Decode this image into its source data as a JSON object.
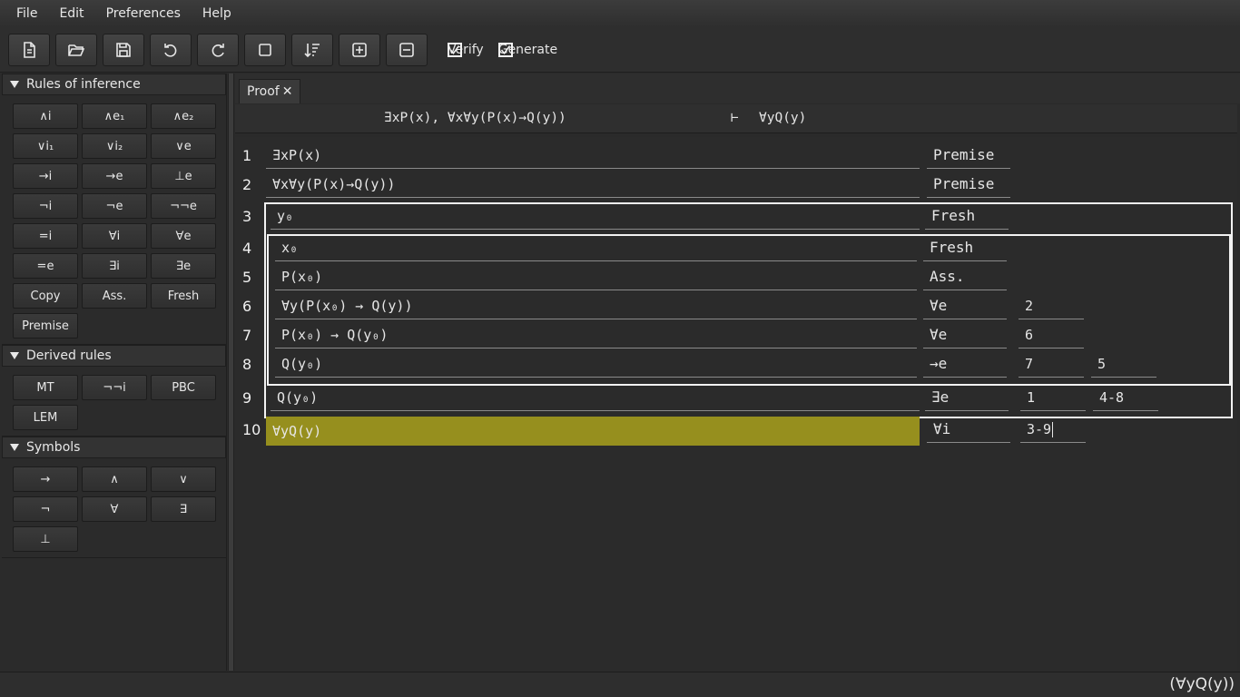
{
  "menu": [
    "File",
    "Edit",
    "Preferences",
    "Help"
  ],
  "toolbar": {
    "buttons": [
      "new-file-icon",
      "open-folder-icon",
      "save-icon",
      "undo-icon",
      "redo-icon",
      "square-icon",
      "sort-icon",
      "add-line-icon",
      "remove-line-icon"
    ],
    "verify_label": "Verify",
    "verify_checked": true,
    "generate_label": "Generate",
    "generate_checked": true
  },
  "sidebar": {
    "rules_title": "Rules of inference",
    "rules": [
      "∧i",
      "∧e₁",
      "∧e₂",
      "∨i₁",
      "∨i₂",
      "∨e",
      "→i",
      "→e",
      "⊥e",
      "¬i",
      "¬e",
      "¬¬e",
      "=i",
      "∀i",
      "∀e",
      "=e",
      "∃i",
      "∃e",
      "Copy",
      "Ass.",
      "Fresh",
      "Premise"
    ],
    "derived_title": "Derived rules",
    "derived": [
      "MT",
      "¬¬i",
      "PBC",
      "LEM"
    ],
    "symbols_title": "Symbols",
    "symbols": [
      "→",
      "∧",
      "∨",
      "¬",
      "∀",
      "∃",
      "⊥"
    ]
  },
  "tab": {
    "label": "Proof",
    "close": "✕"
  },
  "sequent": {
    "premises": "∃xP(x), ∀x∀y(P(x)→Q(y))",
    "turnstile": "⊢",
    "conclusion": "∀yQ(y)"
  },
  "proof": {
    "lines": [
      {
        "num": "1",
        "formula": "∃xP(x)",
        "rule": "Premise",
        "ref1": "",
        "ref2": ""
      },
      {
        "num": "2",
        "formula": "∀x∀y(P(x)→Q(y))",
        "rule": "Premise",
        "ref1": "",
        "ref2": ""
      },
      {
        "num": "3",
        "formula": "y₀",
        "rule": "Fresh",
        "ref1": "",
        "ref2": ""
      },
      {
        "num": "4",
        "formula": "x₀",
        "rule": "Fresh",
        "ref1": "",
        "ref2": ""
      },
      {
        "num": "5",
        "formula": "P(x₀)",
        "rule": "Ass.",
        "ref1": "",
        "ref2": ""
      },
      {
        "num": "6",
        "formula": "∀y(P(x₀) → Q(y))",
        "rule": "∀e",
        "ref1": "2",
        "ref2": ""
      },
      {
        "num": "7",
        "formula": "P(x₀) → Q(y₀)",
        "rule": "∀e",
        "ref1": "6",
        "ref2": ""
      },
      {
        "num": "8",
        "formula": "Q(y₀)",
        "rule": "→e",
        "ref1": "7",
        "ref2": "5"
      },
      {
        "num": "9",
        "formula": "Q(y₀)",
        "rule": "∃e",
        "ref1": "1",
        "ref2": "4-8"
      },
      {
        "num": "10",
        "formula": "∀yQ(y)",
        "rule": "∀i",
        "ref1": "3-9",
        "ref2": ""
      }
    ]
  },
  "status": {
    "text": "(∀yQ(y))"
  },
  "colors": {
    "highlight": "#968f1e",
    "background": "#2b2b2b"
  }
}
